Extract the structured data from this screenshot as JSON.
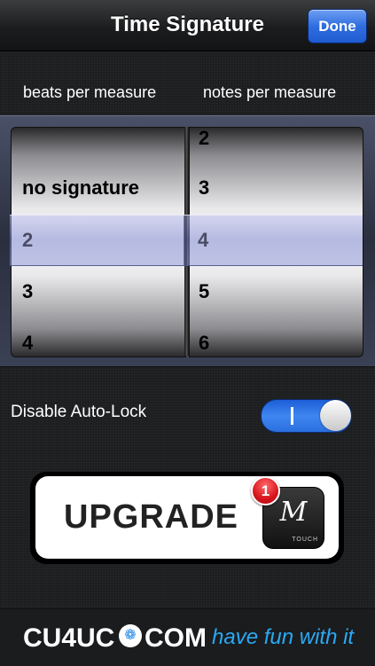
{
  "nav": {
    "title": "Time Signature",
    "done_label": "Done"
  },
  "picker": {
    "left_header": "beats per measure",
    "right_header": "notes per measure",
    "left_rows": [
      "no signature",
      "2",
      "3",
      "4"
    ],
    "right_rows": [
      "2",
      "3",
      "4",
      "5",
      "6"
    ],
    "left_selected": "2",
    "right_selected": "4"
  },
  "settings": {
    "autolock_label": "Disable Auto-Lock",
    "autolock_on": true
  },
  "upgrade": {
    "label": "UPGRADE",
    "badge_count": "1",
    "icon_letter": "M",
    "icon_sub": "TOUCH"
  },
  "footer": {
    "brand_a": "CU4UC",
    "brand_b": "COM",
    "tagline": "have fun with it"
  },
  "colors": {
    "accent": "#2f6ee0",
    "tagline": "#29a9f5",
    "badge": "#d8141e"
  }
}
